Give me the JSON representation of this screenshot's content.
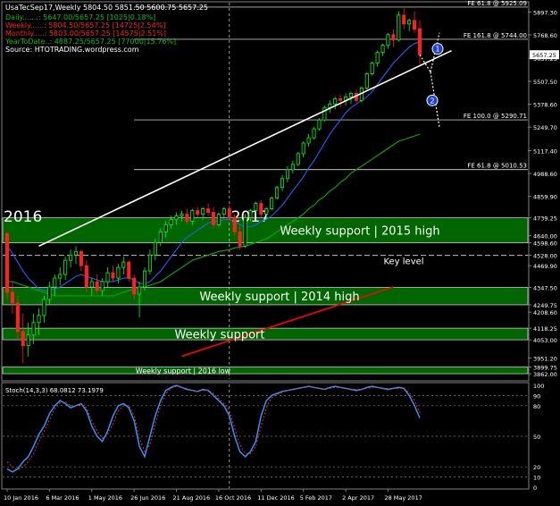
{
  "header": {
    "symbol_line": "UsaTecSep17,Weekly  5804.50 5851.50 5600.75 5657.25",
    "source": "Source: HTOTRADING.wordpress.com",
    "stats": [
      {
        "label": "Daily.......:",
        "value": "5647.00/5657.25 [1025|0.18%]",
        "color": "#00c000"
      },
      {
        "label": "Weekly......:",
        "value": "5804.50/5657.25 [14725|2.54%]",
        "color": "#ff2020"
      },
      {
        "label": "Monthly.....:",
        "value": "5803.00/5657.25 [14575|2.51%]",
        "color": "#ff2020"
      },
      {
        "label": "YearToDate..:",
        "value": "4887.25/5657.25 [77000|15.76%]",
        "color": "#00c000"
      }
    ]
  },
  "chart_data": [
    {
      "type": "line",
      "subtype": "candlestick",
      "title": "UsaTecSep17,Weekly",
      "ylim": [
        3832,
        5950
      ],
      "x_ticks": [
        "10 Jan 2016",
        "6 Mar 2016",
        "1 May 2016",
        "26 Jun 2016",
        "21 Aug 2016",
        "16 Oct 2016",
        "11 Dec 2016",
        "5 Feb 2017",
        "2 Apr 2017",
        "28 May 2017"
      ],
      "y_ticks": [
        "5897.30",
        "5768.60",
        "5637.25",
        "5507.50",
        "5378.60",
        "5249.70",
        "5117.40",
        "4988.60",
        "4859.90",
        "4739.25",
        "4640.00",
        "4598.60",
        "4528.00",
        "4469.90",
        "4347.50",
        "4249.75",
        "4208.60",
        "4118.25",
        "4053.00",
        "3951.20",
        "3899.75",
        "3862.00"
      ],
      "current_price": "5657.25",
      "year_labels": [
        "2016",
        "2017"
      ],
      "horizontal_levels": [
        {
          "label": "FE 61.8 @ 5925.09",
          "value": 5925.09
        },
        {
          "label": "FE 161.8 @ 5744.00",
          "value": 5744.0
        },
        {
          "label": "FE 100.0 @ 5290.71",
          "value": 5290.71
        },
        {
          "label": "FE 61.8 @ 5010.53",
          "value": 5010.53
        }
      ],
      "zones": [
        {
          "label": "Weekly support | 2015 high",
          "low": 4598.6,
          "high": 4739.25
        },
        {
          "label": "Weekly support | 2014 high",
          "low": 4249.75,
          "high": 4347.5
        },
        {
          "label": "Weekly support",
          "low": 4053.0,
          "high": 4118.25
        },
        {
          "label": "Weekly support | 2016 low",
          "low": 3862.0,
          "high": 3899.75
        }
      ],
      "key_level": {
        "label": "Key level",
        "value": 4528.0
      },
      "markers": [
        "1",
        "2"
      ],
      "series": [
        {
          "name": "",
          "kind": "ohlc",
          "values": [
            [
              4650,
              4660,
              4280,
              4320
            ],
            [
              4320,
              4380,
              4200,
              4260
            ],
            [
              4260,
              4300,
              4050,
              4100
            ],
            [
              4100,
              4200,
              3920,
              4020
            ],
            [
              4020,
              4150,
              3960,
              4080
            ],
            [
              4080,
              4200,
              4030,
              4150
            ],
            [
              4150,
              4230,
              4080,
              4190
            ],
            [
              4190,
              4300,
              4150,
              4280
            ],
            [
              4280,
              4380,
              4250,
              4350
            ],
            [
              4350,
              4420,
              4300,
              4400
            ],
            [
              4400,
              4460,
              4360,
              4420
            ],
            [
              4420,
              4520,
              4390,
              4500
            ],
            [
              4500,
              4560,
              4460,
              4530
            ],
            [
              4530,
              4580,
              4480,
              4550
            ],
            [
              4550,
              4560,
              4440,
              4470
            ],
            [
              4470,
              4500,
              4320,
              4350
            ],
            [
              4350,
              4400,
              4300,
              4380
            ],
            [
              4380,
              4420,
              4310,
              4330
            ],
            [
              4330,
              4400,
              4300,
              4380
            ],
            [
              4380,
              4460,
              4350,
              4430
            ],
            [
              4430,
              4470,
              4380,
              4400
            ],
            [
              4400,
              4480,
              4370,
              4460
            ],
            [
              4460,
              4520,
              4420,
              4490
            ],
            [
              4490,
              4500,
              4380,
              4400
            ],
            [
              4400,
              4420,
              4280,
              4310
            ],
            [
              4310,
              4380,
              4180,
              4350
            ],
            [
              4350,
              4460,
              4330,
              4440
            ],
            [
              4440,
              4560,
              4420,
              4530
            ],
            [
              4530,
              4620,
              4500,
              4600
            ],
            [
              4600,
              4680,
              4580,
              4660
            ],
            [
              4660,
              4720,
              4630,
              4700
            ],
            [
              4700,
              4750,
              4680,
              4730
            ],
            [
              4730,
              4770,
              4700,
              4750
            ],
            [
              4750,
              4780,
              4720,
              4760
            ],
            [
              4760,
              4790,
              4700,
              4720
            ],
            [
              4720,
              4790,
              4700,
              4780
            ],
            [
              4780,
              4800,
              4740,
              4760
            ],
            [
              4760,
              4800,
              4730,
              4790
            ],
            [
              4790,
              4820,
              4750,
              4770
            ],
            [
              4770,
              4800,
              4680,
              4700
            ],
            [
              4700,
              4770,
              4690,
              4760
            ],
            [
              4760,
              4800,
              4740,
              4790
            ],
            [
              4790,
              4810,
              4720,
              4740
            ],
            [
              4740,
              4760,
              4640,
              4660
            ],
            [
              4660,
              4690,
              4560,
              4580
            ],
            [
              4580,
              4760,
              4570,
              4740
            ],
            [
              4740,
              4790,
              4720,
              4780
            ],
            [
              4780,
              4830,
              4770,
              4820
            ],
            [
              4820,
              4840,
              4740,
              4760
            ],
            [
              4760,
              4800,
              4730,
              4790
            ],
            [
              4790,
              4860,
              4780,
              4850
            ],
            [
              4850,
              4920,
              4840,
              4910
            ],
            [
              4910,
              4980,
              4890,
              4960
            ],
            [
              4960,
              5030,
              4940,
              5010
            ],
            [
              5010,
              5060,
              4990,
              5040
            ],
            [
              5040,
              5110,
              5030,
              5100
            ],
            [
              5100,
              5170,
              5080,
              5160
            ],
            [
              5160,
              5210,
              5140,
              5190
            ],
            [
              5190,
              5250,
              5180,
              5240
            ],
            [
              5240,
              5300,
              5230,
              5290
            ],
            [
              5290,
              5370,
              5280,
              5360
            ],
            [
              5360,
              5400,
              5330,
              5380
            ],
            [
              5380,
              5420,
              5350,
              5410
            ],
            [
              5410,
              5430,
              5360,
              5400
            ],
            [
              5400,
              5440,
              5370,
              5420
            ],
            [
              5420,
              5450,
              5380,
              5440
            ],
            [
              5440,
              5460,
              5390,
              5400
            ],
            [
              5400,
              5480,
              5390,
              5470
            ],
            [
              5470,
              5560,
              5460,
              5550
            ],
            [
              5550,
              5620,
              5540,
              5610
            ],
            [
              5610,
              5680,
              5590,
              5670
            ],
            [
              5670,
              5720,
              5650,
              5710
            ],
            [
              5710,
              5780,
              5690,
              5770
            ],
            [
              5770,
              5800,
              5700,
              5740
            ],
            [
              5740,
              5900,
              5730,
              5880
            ],
            [
              5880,
              5920,
              5800,
              5830
            ],
            [
              5830,
              5860,
              5790,
              5850
            ],
            [
              5850,
              5900,
              5780,
              5800
            ],
            [
              5804.5,
              5851.5,
              5600.75,
              5657.25
            ]
          ]
        },
        {
          "name": "",
          "kind": "ma",
          "color": "#2060ff",
          "values": [
            4580,
            4540,
            4490,
            4440,
            4400,
            4370,
            4340,
            4330,
            4330,
            4340,
            4350,
            4370,
            4390,
            4410,
            4420,
            4410,
            4400,
            4390,
            4380,
            4380,
            4380,
            4390,
            4400,
            4400,
            4390,
            4370,
            4370,
            4380,
            4410,
            4440,
            4480,
            4520,
            4560,
            4600,
            4630,
            4650,
            4670,
            4690,
            4710,
            4720,
            4720,
            4730,
            4730,
            4720,
            4700,
            4690,
            4690,
            4700,
            4720,
            4730,
            4750,
            4780,
            4810,
            4850,
            4890,
            4930,
            4970,
            5020,
            5060,
            5110,
            5160,
            5210,
            5250,
            5290,
            5330,
            5360,
            5380,
            5400,
            5420,
            5450,
            5490,
            5530,
            5570,
            5610,
            5640,
            5670,
            5700,
            5720,
            5730
          ]
        },
        {
          "name": "",
          "kind": "ma",
          "color": "#00b000",
          "values": [
            4380,
            4380,
            4370,
            4360,
            4350,
            4340,
            4330,
            4320,
            4310,
            4300,
            4300,
            4300,
            4300,
            4300,
            4300,
            4300,
            4300,
            4300,
            4300,
            4300,
            4300,
            4310,
            4320,
            4330,
            4340,
            4350,
            4350,
            4360,
            4370,
            4380,
            4400,
            4420,
            4440,
            4460,
            4480,
            4500,
            4510,
            4520,
            4530,
            4540,
            4550,
            4555,
            4560,
            4570,
            4575,
            4580,
            4590,
            4600,
            4610,
            4620,
            4640,
            4660,
            4680,
            4700,
            4720,
            4740,
            4760,
            4790,
            4810,
            4840,
            4860,
            4890,
            4910,
            4940,
            4960,
            4990,
            5010,
            5030,
            5050,
            5070,
            5090,
            5110,
            5130,
            5150,
            5170,
            5180,
            5190,
            5200,
            5210
          ]
        }
      ],
      "trendlines": [
        {
          "color": "#ffffff",
          "from": [
            6,
            4580
          ],
          "to": [
            84,
            5680
          ]
        },
        {
          "color": "#ff0000",
          "from": [
            33,
            3960
          ],
          "to": [
            73,
            4350
          ]
        }
      ]
    },
    {
      "type": "line",
      "title": "Stoch(14,3,3) 68.0812 73.1979",
      "ylim": [
        0,
        100
      ],
      "y_ticks": [
        "100",
        "90",
        "80",
        "50",
        "20",
        "10",
        "0"
      ],
      "series": [
        {
          "name": "",
          "color": "#3090ff",
          "values": [
            18,
            15,
            18,
            25,
            30,
            40,
            52,
            60,
            72,
            80,
            85,
            82,
            78,
            80,
            82,
            75,
            60,
            50,
            45,
            55,
            70,
            80,
            82,
            78,
            65,
            40,
            30,
            50,
            70,
            85,
            95,
            98,
            100,
            98,
            96,
            95,
            94,
            96,
            95,
            90,
            85,
            80,
            70,
            50,
            35,
            30,
            35,
            45,
            70,
            85,
            90,
            92,
            94,
            95,
            96,
            97,
            98,
            99,
            98,
            97,
            96,
            98,
            99,
            98,
            97,
            96,
            95,
            96,
            98,
            99,
            98,
            97,
            96,
            97,
            98,
            97,
            90,
            80,
            68
          ]
        },
        {
          "name": "",
          "color": "#ff3030",
          "dashed": true,
          "values": [
            25,
            20,
            17,
            20,
            25,
            33,
            45,
            55,
            66,
            77,
            83,
            84,
            80,
            80,
            81,
            78,
            65,
            55,
            48,
            52,
            62,
            75,
            80,
            80,
            70,
            48,
            35,
            42,
            62,
            80,
            92,
            97,
            99,
            98,
            97,
            95,
            94,
            95,
            95,
            92,
            87,
            82,
            75,
            58,
            42,
            33,
            33,
            40,
            60,
            78,
            88,
            91,
            93,
            95,
            96,
            97,
            98,
            99,
            98,
            97,
            96,
            97,
            98,
            98,
            97,
            96,
            96,
            96,
            97,
            98,
            98,
            97,
            97,
            97,
            97,
            97,
            93,
            85,
            73
          ]
        }
      ]
    }
  ]
}
